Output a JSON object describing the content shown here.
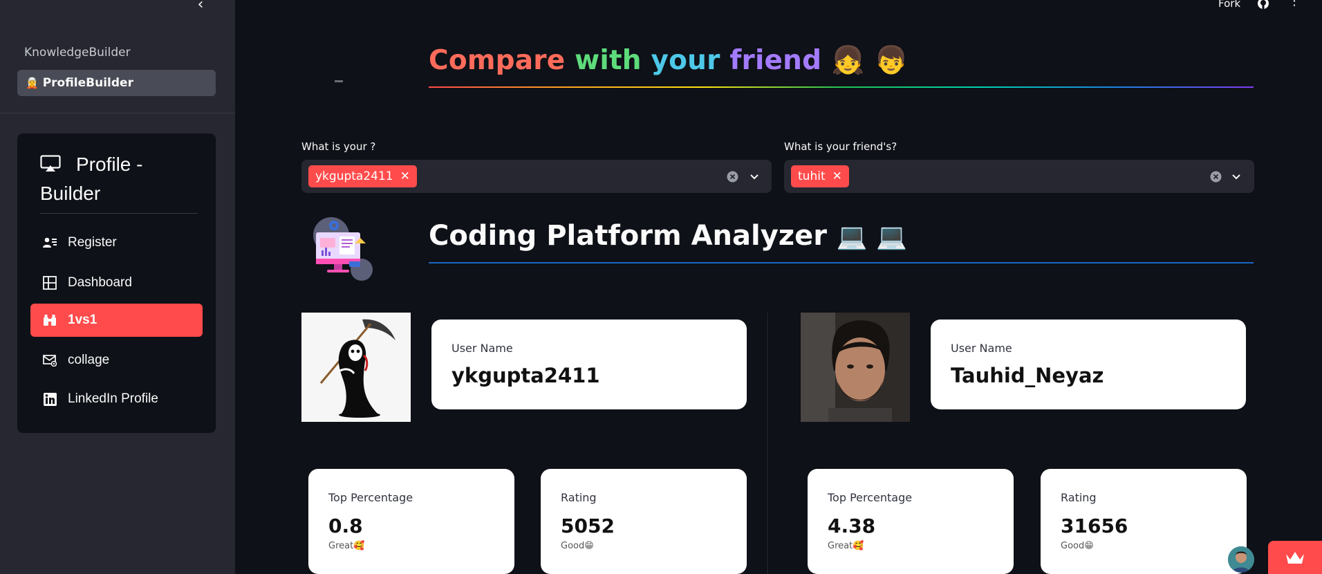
{
  "sidebar": {
    "apps": [
      {
        "label": "KnowledgeBuilder"
      },
      {
        "label": "ProfileBuilder",
        "emoji": "🧝"
      }
    ],
    "menu": {
      "title": "Profile - Builder",
      "items": [
        {
          "label": "Register",
          "icon": "person-lines-icon"
        },
        {
          "label": "Dashboard",
          "icon": "grid-icon"
        },
        {
          "label": "1vs1",
          "icon": "binoculars-icon"
        },
        {
          "label": "collage",
          "icon": "envelope-at-icon"
        },
        {
          "label": "LinkedIn Profile",
          "icon": "linkedin-icon"
        }
      ],
      "active_index": 2
    }
  },
  "topbar": {
    "fork_label": "Fork"
  },
  "header": {
    "words": [
      "Compare",
      "with",
      "your",
      "friend"
    ],
    "emojis": "👧 👦"
  },
  "selectors": {
    "you": {
      "label": "What is your ?",
      "tag": "ykgupta2411"
    },
    "friend": {
      "label": "What is your friend's?",
      "tag": "tuhit"
    }
  },
  "analyzer": {
    "title": "Coding Platform Analyzer",
    "emojis": "💻 💻"
  },
  "users": [
    {
      "username_label": "User Name",
      "username": "ykgupta2411",
      "stats": [
        {
          "label": "Top Percentage",
          "value": "0.8",
          "sub": "Great🥰"
        },
        {
          "label": "Rating",
          "value": "5052",
          "sub": "Good😁"
        }
      ]
    },
    {
      "username_label": "User Name",
      "username": "Tauhid_Neyaz",
      "stats": [
        {
          "label": "Top Percentage",
          "value": "4.38",
          "sub": "Great🥰"
        },
        {
          "label": "Rating",
          "value": "31656",
          "sub": "Good😁"
        }
      ]
    }
  ],
  "colors": {
    "accent": "#ff4b4b",
    "background": "#0e1117",
    "sidebar": "#262730"
  }
}
